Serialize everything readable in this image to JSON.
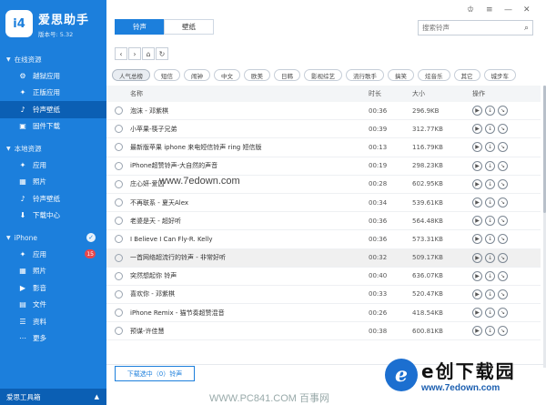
{
  "sidebar": {
    "app_name": "爱思助手",
    "version": "版本号: 5.32",
    "logo_text": "i4",
    "sections": {
      "online": "在线资源",
      "local": "本地资源",
      "device": "iPhone"
    },
    "online_items": [
      "越狱应用",
      "正版应用",
      "铃声壁纸",
      "固件下载"
    ],
    "local_items": [
      "应用",
      "照片",
      "铃声壁纸",
      "下载中心"
    ],
    "device_items": [
      "应用",
      "照片",
      "影音",
      "文件",
      "资料",
      "更多"
    ],
    "apps_badge": "15",
    "footer": "爱思工具箱"
  },
  "toolbar": {
    "tab_ringtone": "铃声",
    "tab_wallpaper": "壁纸",
    "search_placeholder": "搜索铃声"
  },
  "categories": [
    "人气总榜",
    "短信",
    "闹钟",
    "中文",
    "欧美",
    "日韩",
    "影视综艺",
    "流行歌手",
    "搞笑",
    "炫音乐",
    "其它",
    "城步车"
  ],
  "columns": {
    "name": "名称",
    "duration": "时长",
    "size": "大小",
    "ops": "操作"
  },
  "rows": [
    {
      "name": "泡沫 - 邓紫棋",
      "dur": "00:36",
      "size": "296.9KB"
    },
    {
      "name": "小苹果-筷子兄弟",
      "dur": "00:39",
      "size": "312.77KB"
    },
    {
      "name": "最新版苹果 iphone 来电短信铃声 ring 短信版",
      "dur": "00:13",
      "size": "116.79KB"
    },
    {
      "name": "iPhone超赞铃声-大自然的声音",
      "dur": "00:19",
      "size": "298.23KB"
    },
    {
      "name": "庄心妍-爱囚",
      "dur": "00:28",
      "size": "602.95KB"
    },
    {
      "name": "不再联系 - 夏天Alex",
      "dur": "00:34",
      "size": "539.61KB"
    },
    {
      "name": "老婆是天 - 超好听",
      "dur": "00:36",
      "size": "564.48KB"
    },
    {
      "name": "I Believe I Can Fly-R. Kelly",
      "dur": "00:36",
      "size": "573.31KB"
    },
    {
      "name": "一首网络超流行的铃声 - 非常好听",
      "dur": "00:32",
      "size": "509.17KB"
    },
    {
      "name": "突然想起你 铃声",
      "dur": "00:40",
      "size": "636.07KB"
    },
    {
      "name": "喜欢你 - 邓紫棋",
      "dur": "00:33",
      "size": "520.47KB"
    },
    {
      "name": "iPhone Remix - 猫节奏超赞混音",
      "dur": "00:26",
      "size": "418.54KB"
    },
    {
      "name": "预谋-许佳慧",
      "dur": "00:38",
      "size": "600.81KB"
    }
  ],
  "download_button": "下载选中（0）铃声",
  "watermarks": {
    "site_center": "www.7edown.com",
    "bottom_text": "WWW.PC841.COM 百事网",
    "logo_letter": "e",
    "logo_title": "e创下载园",
    "logo_url": "www.7edown.com"
  }
}
